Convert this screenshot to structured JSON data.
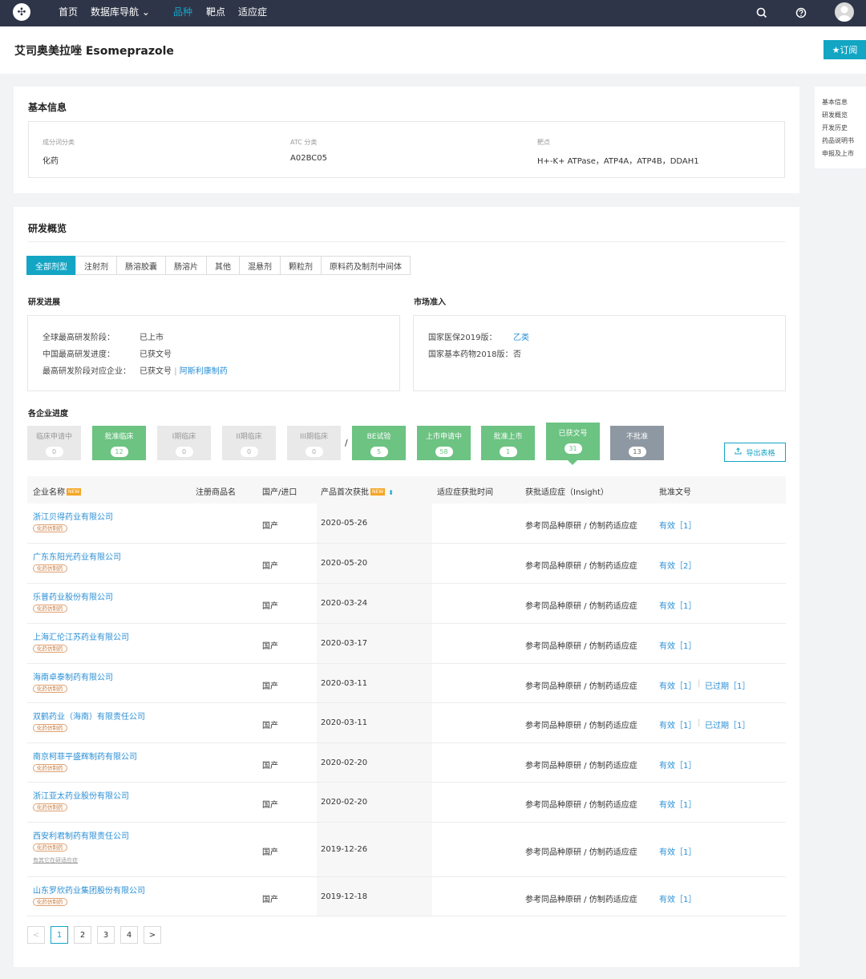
{
  "nav": {
    "items": [
      "首页",
      "数据库导航 ⌄",
      "品种",
      "靶点",
      "适应症"
    ]
  },
  "page": {
    "title": "艾司奥美拉唑 Esomeprazole",
    "subscribe_label": "★订阅"
  },
  "sidenav": [
    "基本信息",
    "研发概览",
    "开发历史",
    "药品说明书",
    "申报及上市"
  ],
  "basic": {
    "title": "基本信息",
    "fields": [
      {
        "label": "成分词分类",
        "value": "化药"
      },
      {
        "label": "ATC 分类",
        "value": "A02BC05"
      },
      {
        "label": "靶点",
        "value": "H+-K+ ATPase，ATP4A，ATP4B，DDAH1"
      }
    ]
  },
  "overview": {
    "title": "研发概览",
    "tabs": [
      "全部剂型",
      "注射剂",
      "肠溶胶囊",
      "肠溶片",
      "其他",
      "混悬剂",
      "颗粒剂",
      "原料药及制剂中间体"
    ],
    "progress_title": "研发进展",
    "progress": [
      {
        "label": "全球最高研发阶段：",
        "value": "已上市"
      },
      {
        "label": "中国最高研发进度：",
        "value": "已获文号"
      },
      {
        "label": "最高研发阶段对应企业：",
        "value": "已获文号",
        "link": "阿斯利康制药",
        "sep": "|"
      }
    ],
    "market_title": "市场准入",
    "market": [
      {
        "label": "国家医保2019版：",
        "value": "乙类"
      },
      {
        "label": "国家基本药物2018版：",
        "value": "否"
      }
    ],
    "company_title": "各企业进度",
    "stages": [
      {
        "label": "临床申请中",
        "count": "0",
        "style": "none"
      },
      {
        "label": "批准临床",
        "count": "12",
        "style": "green"
      },
      {
        "label": "I期临床",
        "count": "0",
        "style": "none"
      },
      {
        "label": "II期临床",
        "count": "0",
        "style": "none"
      },
      {
        "label": "III期临床",
        "count": "0",
        "style": "none"
      },
      {
        "label": "BE试验",
        "count": "5",
        "style": "green"
      },
      {
        "label": "上市申请中",
        "count": "58",
        "style": "green"
      },
      {
        "label": "批准上市",
        "count": "1",
        "style": "green"
      },
      {
        "label": "已获文号",
        "count": "31",
        "style": "green"
      },
      {
        "label": "不批准",
        "count": "13",
        "style": "grey"
      }
    ],
    "stage_sep": "/",
    "export_label": "导出表格"
  },
  "table": {
    "headers": [
      "企业名称",
      "注册商品名",
      "国产/进口",
      "产品首次获批",
      "适应症获批时间",
      "获批适应症（Insight）",
      "批准文号"
    ],
    "new_badge": "NEW",
    "rows": [
      {
        "company": "浙江贝得药业有限公司",
        "tag": "化药仿制药",
        "origin": "国产",
        "date": "2020-05-26",
        "indication": "参考同品种原研 / 仿制药适应症",
        "approval": "有效［1］",
        "expired": ""
      },
      {
        "company": "广东东阳光药业有限公司",
        "tag": "化药仿制药",
        "origin": "国产",
        "date": "2020-05-20",
        "indication": "参考同品种原研 / 仿制药适应症",
        "approval": "有效［2］",
        "expired": ""
      },
      {
        "company": "乐普药业股份有限公司",
        "tag": "化药仿制药",
        "origin": "国产",
        "date": "2020-03-24",
        "indication": "参考同品种原研 / 仿制药适应症",
        "approval": "有效［1］",
        "expired": ""
      },
      {
        "company": "上海汇伦江苏药业有限公司",
        "tag": "化药仿制药",
        "origin": "国产",
        "date": "2020-03-17",
        "indication": "参考同品种原研 / 仿制药适应症",
        "approval": "有效［1］",
        "expired": ""
      },
      {
        "company": "海南卓泰制药有限公司",
        "tag": "化药仿制药",
        "origin": "国产",
        "date": "2020-03-11",
        "indication": "参考同品种原研 / 仿制药适应症",
        "approval": "有效［1］",
        "expired": "已过期［1］"
      },
      {
        "company": "双鹤药业（海南）有限责任公司",
        "tag": "化药仿制药",
        "origin": "国产",
        "date": "2020-03-11",
        "indication": "参考同品种原研 / 仿制药适应症",
        "approval": "有效［1］",
        "expired": "已过期［1］"
      },
      {
        "company": "南京柯菲平盛辉制药有限公司",
        "tag": "化药仿制药",
        "origin": "国产",
        "date": "2020-02-20",
        "indication": "参考同品种原研 / 仿制药适应症",
        "approval": "有效［1］",
        "expired": ""
      },
      {
        "company": "浙江亚太药业股份有限公司",
        "tag": "化药仿制药",
        "origin": "国产",
        "date": "2020-02-20",
        "indication": "参考同品种原研 / 仿制药适应症",
        "approval": "有效［1］",
        "expired": ""
      },
      {
        "company": "西安利君制药有限责任公司",
        "tag": "化药仿制药",
        "note": "有其它在研适应症",
        "origin": "国产",
        "date": "2019-12-26",
        "indication": "参考同品种原研 / 仿制药适应症",
        "approval": "有效［1］",
        "expired": ""
      },
      {
        "company": "山东罗欣药业集团股份有限公司",
        "tag": "化药仿制药",
        "origin": "国产",
        "date": "2019-12-18",
        "indication": "参考同品种原研 / 仿制药适应症",
        "approval": "有效［1］",
        "expired": ""
      }
    ]
  },
  "pagination": {
    "prev": "<",
    "pages": [
      "1",
      "2",
      "3",
      "4"
    ],
    "next": ">",
    "current": "1"
  },
  "colors": {
    "accent": "#14a5c5",
    "nav_bg": "#2f3548",
    "stage_green": "#6cc382",
    "stage_grey": "#8e98a3",
    "tag": "#c87a3e"
  }
}
